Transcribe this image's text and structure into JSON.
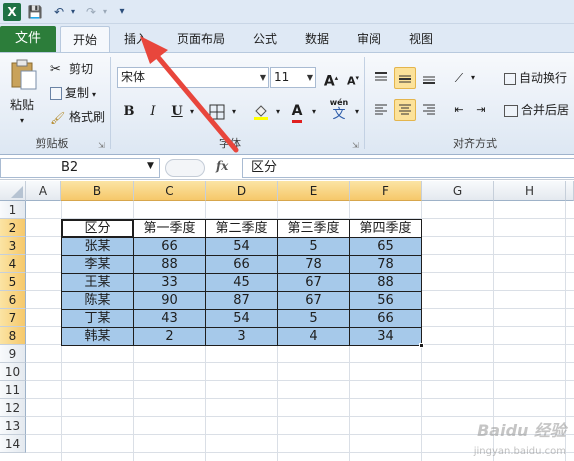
{
  "qat": {
    "logo": "X",
    "save": "💾",
    "undo": "↶",
    "redo": "↷",
    "more": "▾"
  },
  "tabs": {
    "file": "文件",
    "items": [
      "开始",
      "插入",
      "页面布局",
      "公式",
      "数据",
      "审阅",
      "视图"
    ],
    "active": "开始"
  },
  "ribbon": {
    "clipboard": {
      "paste": "粘贴",
      "cut": "剪切",
      "copy": "复制",
      "format_painter": "格式刷",
      "label": "剪贴板"
    },
    "font": {
      "name": "宋体",
      "size": "11",
      "grow": "A",
      "shrink": "A",
      "bold": "B",
      "italic": "I",
      "underline": "U",
      "font_color": "A",
      "wen": "wén",
      "wen_char": "文",
      "label": "字体"
    },
    "alignment": {
      "wrap_text": "自动换行",
      "merge_center": "合并后居",
      "label": "对齐方式"
    }
  },
  "formula_bar": {
    "name_box": "B2",
    "fx": "fx",
    "value": "区分"
  },
  "sheet": {
    "columns": [
      "A",
      "B",
      "C",
      "D",
      "E",
      "F",
      "G",
      "H"
    ],
    "selected_columns": [
      "B",
      "C",
      "D",
      "E",
      "F"
    ],
    "rows": [
      "1",
      "2",
      "3",
      "4",
      "5",
      "6",
      "7",
      "8",
      "9",
      "10",
      "11",
      "12",
      "13",
      "14"
    ],
    "selected_rows": [
      "2",
      "3",
      "4",
      "5",
      "6",
      "7",
      "8"
    ],
    "table": {
      "headers": [
        "区分",
        "第一季度",
        "第二季度",
        "第三季度",
        "第四季度"
      ],
      "rows": [
        [
          "张某",
          "66",
          "54",
          "5",
          "65"
        ],
        [
          "李某",
          "88",
          "66",
          "78",
          "78"
        ],
        [
          "王某",
          "33",
          "45",
          "67",
          "88"
        ],
        [
          "陈某",
          "90",
          "87",
          "67",
          "56"
        ],
        [
          "丁某",
          "43",
          "54",
          "5",
          "66"
        ],
        [
          "韩某",
          "2",
          "3",
          "4",
          "34"
        ]
      ]
    }
  },
  "colors": {
    "selection_fill": "#a6c9ea",
    "header_highlight": "#f6c86a",
    "arrow": "#e8463c",
    "file_tab": "#2c7d3a"
  },
  "watermark": {
    "brand": "Baidu 经验",
    "url": "jingyan.baidu.com"
  }
}
